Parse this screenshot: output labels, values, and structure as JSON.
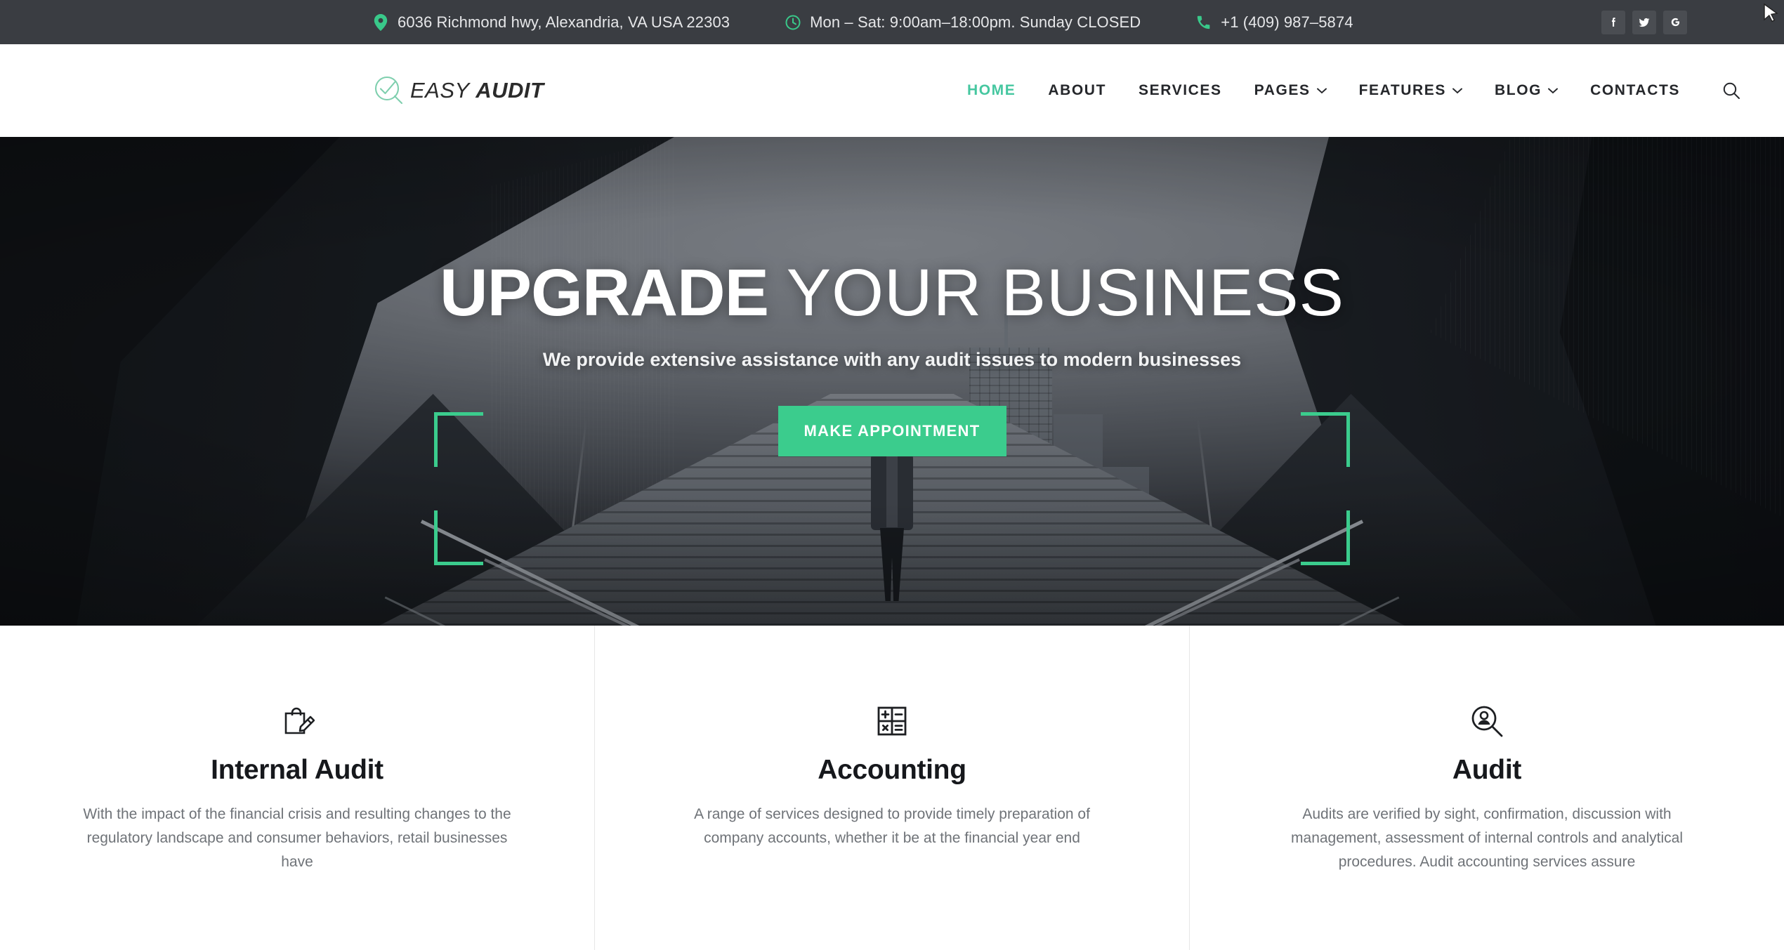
{
  "topbar": {
    "address": "6036 Richmond hwy, Alexandria, VA USA 22303",
    "hours": "Mon – Sat: 9:00am–18:00pm. Sunday CLOSED",
    "phone": "+1 (409) 987–5874",
    "icons": {
      "address": "map-pin-icon",
      "hours": "clock-icon",
      "phone": "phone-icon"
    },
    "social": [
      {
        "name": "facebook",
        "label": "f"
      },
      {
        "name": "twitter",
        "label": "t"
      },
      {
        "name": "google",
        "label": "G"
      }
    ],
    "bg_color": "#3a3d42",
    "icon_color": "#39c98a"
  },
  "header": {
    "logo": {
      "text_light": "EASY ",
      "text_bold": "AUDIT",
      "mark": "check-circle-magnifier-icon"
    },
    "nav": [
      {
        "label": "HOME",
        "active": true,
        "dropdown": false
      },
      {
        "label": "ABOUT",
        "active": false,
        "dropdown": false
      },
      {
        "label": "SERVICES",
        "active": false,
        "dropdown": false
      },
      {
        "label": "PAGES",
        "active": false,
        "dropdown": true
      },
      {
        "label": "FEATURES",
        "active": false,
        "dropdown": true
      },
      {
        "label": "BLOG",
        "active": false,
        "dropdown": true
      },
      {
        "label": "CONTACTS",
        "active": false,
        "dropdown": false
      }
    ],
    "search_icon": "search-icon",
    "active_color": "#46c7a0"
  },
  "hero": {
    "title_strong": "UPGRADE",
    "title_light": " YOUR BUSINESS",
    "subtitle": "We provide extensive assistance with any audit issues to modern businesses",
    "button": "MAKE APPOINTMENT",
    "accent_color": "#3bcc8d"
  },
  "services": [
    {
      "icon": "bag-pencil-icon",
      "title": "Internal Audit",
      "text": "With the impact of the financial crisis and resulting changes to the regulatory landscape and consumer behaviors, retail businesses have"
    },
    {
      "icon": "calculator-icon",
      "title": "Accounting",
      "text": "A range of services designed to provide timely preparation of company accounts, whether it be at the financial year end"
    },
    {
      "icon": "person-magnifier-icon",
      "title": "Audit",
      "text": "Audits are verified by sight, confirmation, discussion with management, assessment of internal controls and analytical procedures. Audit accounting services assure"
    }
  ]
}
